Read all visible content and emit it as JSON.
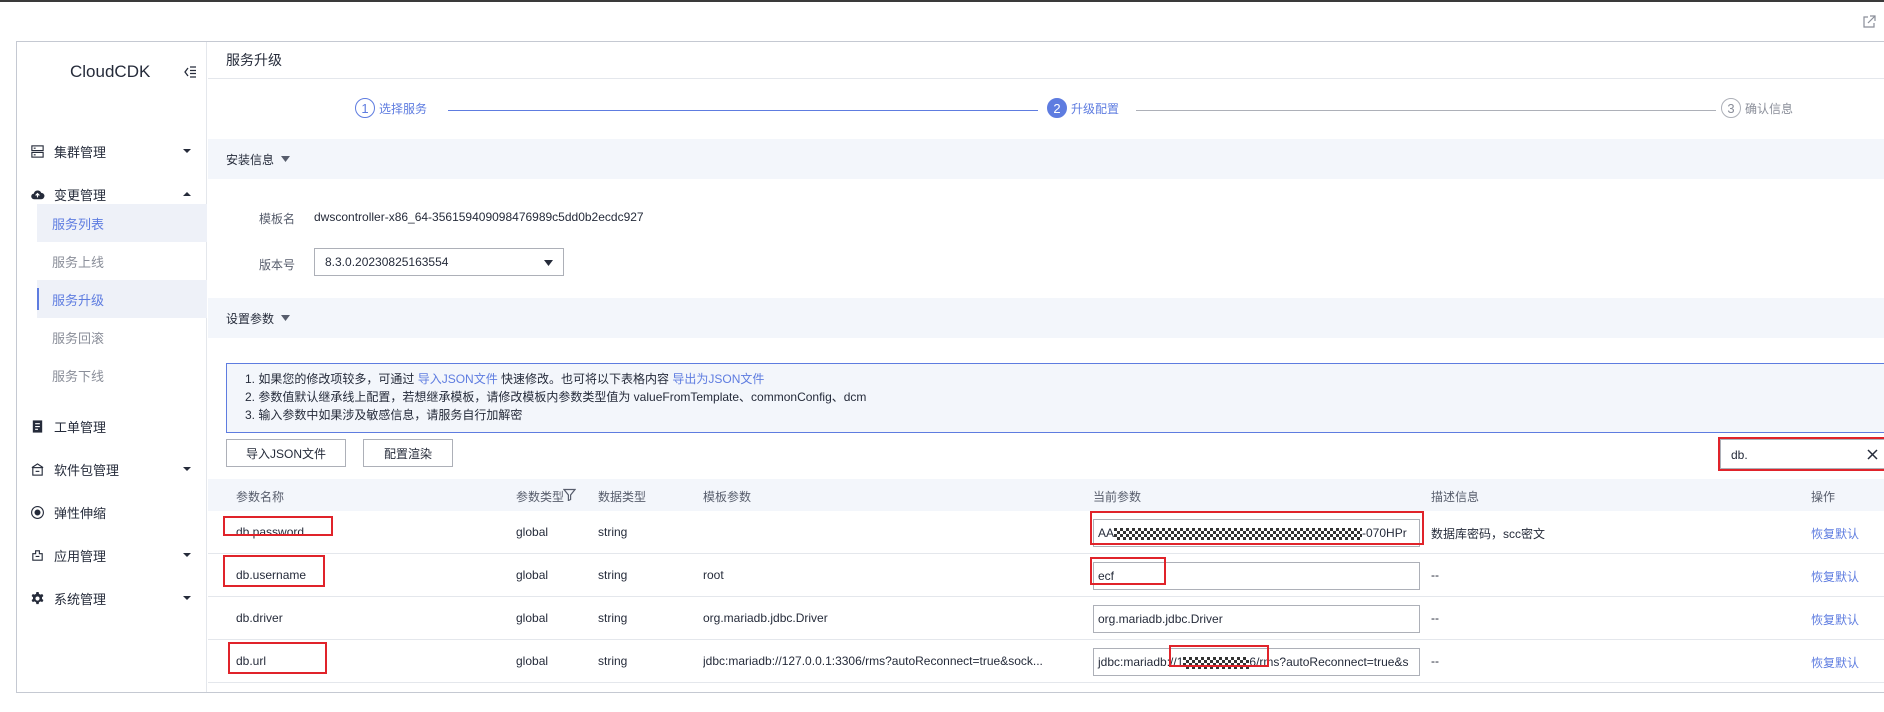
{
  "sidebar": {
    "brand": "CloudCDK",
    "items": [
      {
        "label": "集群管理",
        "icon": "server-icon"
      },
      {
        "label": "变更管理",
        "icon": "cloud-icon"
      },
      {
        "label": "工单管理",
        "icon": "ticket-icon"
      },
      {
        "label": "软件包管理",
        "icon": "package-icon"
      },
      {
        "label": "弹性伸缩",
        "icon": "scaling-icon"
      },
      {
        "label": "应用管理",
        "icon": "app-icon"
      },
      {
        "label": "系统管理",
        "icon": "gear-icon"
      }
    ],
    "sub_items": [
      {
        "label": "服务列表"
      },
      {
        "label": "服务上线"
      },
      {
        "label": "服务升级"
      },
      {
        "label": "服务回滚"
      },
      {
        "label": "服务下线"
      }
    ]
  },
  "page": {
    "title": "服务升级"
  },
  "steps": [
    {
      "num": "1",
      "label": "选择服务"
    },
    {
      "num": "2",
      "label": "升级配置"
    },
    {
      "num": "3",
      "label": "确认信息"
    }
  ],
  "install_info": {
    "section_label": "安装信息",
    "template_label": "模板名",
    "template_value": "dwscontroller-x86_64-356159409098476989c5dd0b2ecdc927",
    "version_label": "版本号",
    "version_value": "8.3.0.20230825163554"
  },
  "params": {
    "section_label": "设置参数",
    "notice": {
      "line1_pre": "1. 如果您的修改项较多，可通过 ",
      "line1_link1": "导入JSON文件",
      "line1_mid": " 快速修改。也可将以下表格内容 ",
      "line1_link2": "导出为JSON文件",
      "line2": "2. 参数值默认继承线上配置，若想继承模板，请修改模板内参数类型值为 valueFromTemplate、commonConfig、dcm",
      "line3": "3. 输入参数中如果涉及敏感信息，请服务自行加解密"
    },
    "import_button": "导入JSON文件",
    "render_button": "配置渲染",
    "search_value": "db."
  },
  "table": {
    "columns": [
      "参数名称",
      "参数类型",
      "数据类型",
      "模板参数",
      "当前参数",
      "描述信息",
      "操作"
    ],
    "rows": [
      {
        "name": "db.password",
        "ptype": "global",
        "dtype": "string",
        "template": "",
        "current_pre": "AA",
        "current_post": "-070HPr",
        "desc": "数据库密码，scc密文",
        "action": "恢复默认"
      },
      {
        "name": "db.username",
        "ptype": "global",
        "dtype": "string",
        "template": "root",
        "current": "ecf",
        "desc": "--",
        "action": "恢复默认"
      },
      {
        "name": "db.driver",
        "ptype": "global",
        "dtype": "string",
        "template": "org.mariadb.jdbc.Driver",
        "current": "org.mariadb.jdbc.Driver",
        "desc": "--",
        "action": "恢复默认"
      },
      {
        "name": "db.url",
        "ptype": "global",
        "dtype": "string",
        "template": "jdbc:mariadb://127.0.0.1:3306/rms?autoReconnect=true&sock...",
        "current_pre": "jdbc:mariadb://1",
        "current_post": "6/rms?autoReconnect=true&s",
        "desc": "--",
        "action": "恢复默认"
      }
    ]
  },
  "colors": {
    "accent": "#5e7ce0",
    "highlight": "#e0232a",
    "section_bg": "#f3f6fb"
  }
}
